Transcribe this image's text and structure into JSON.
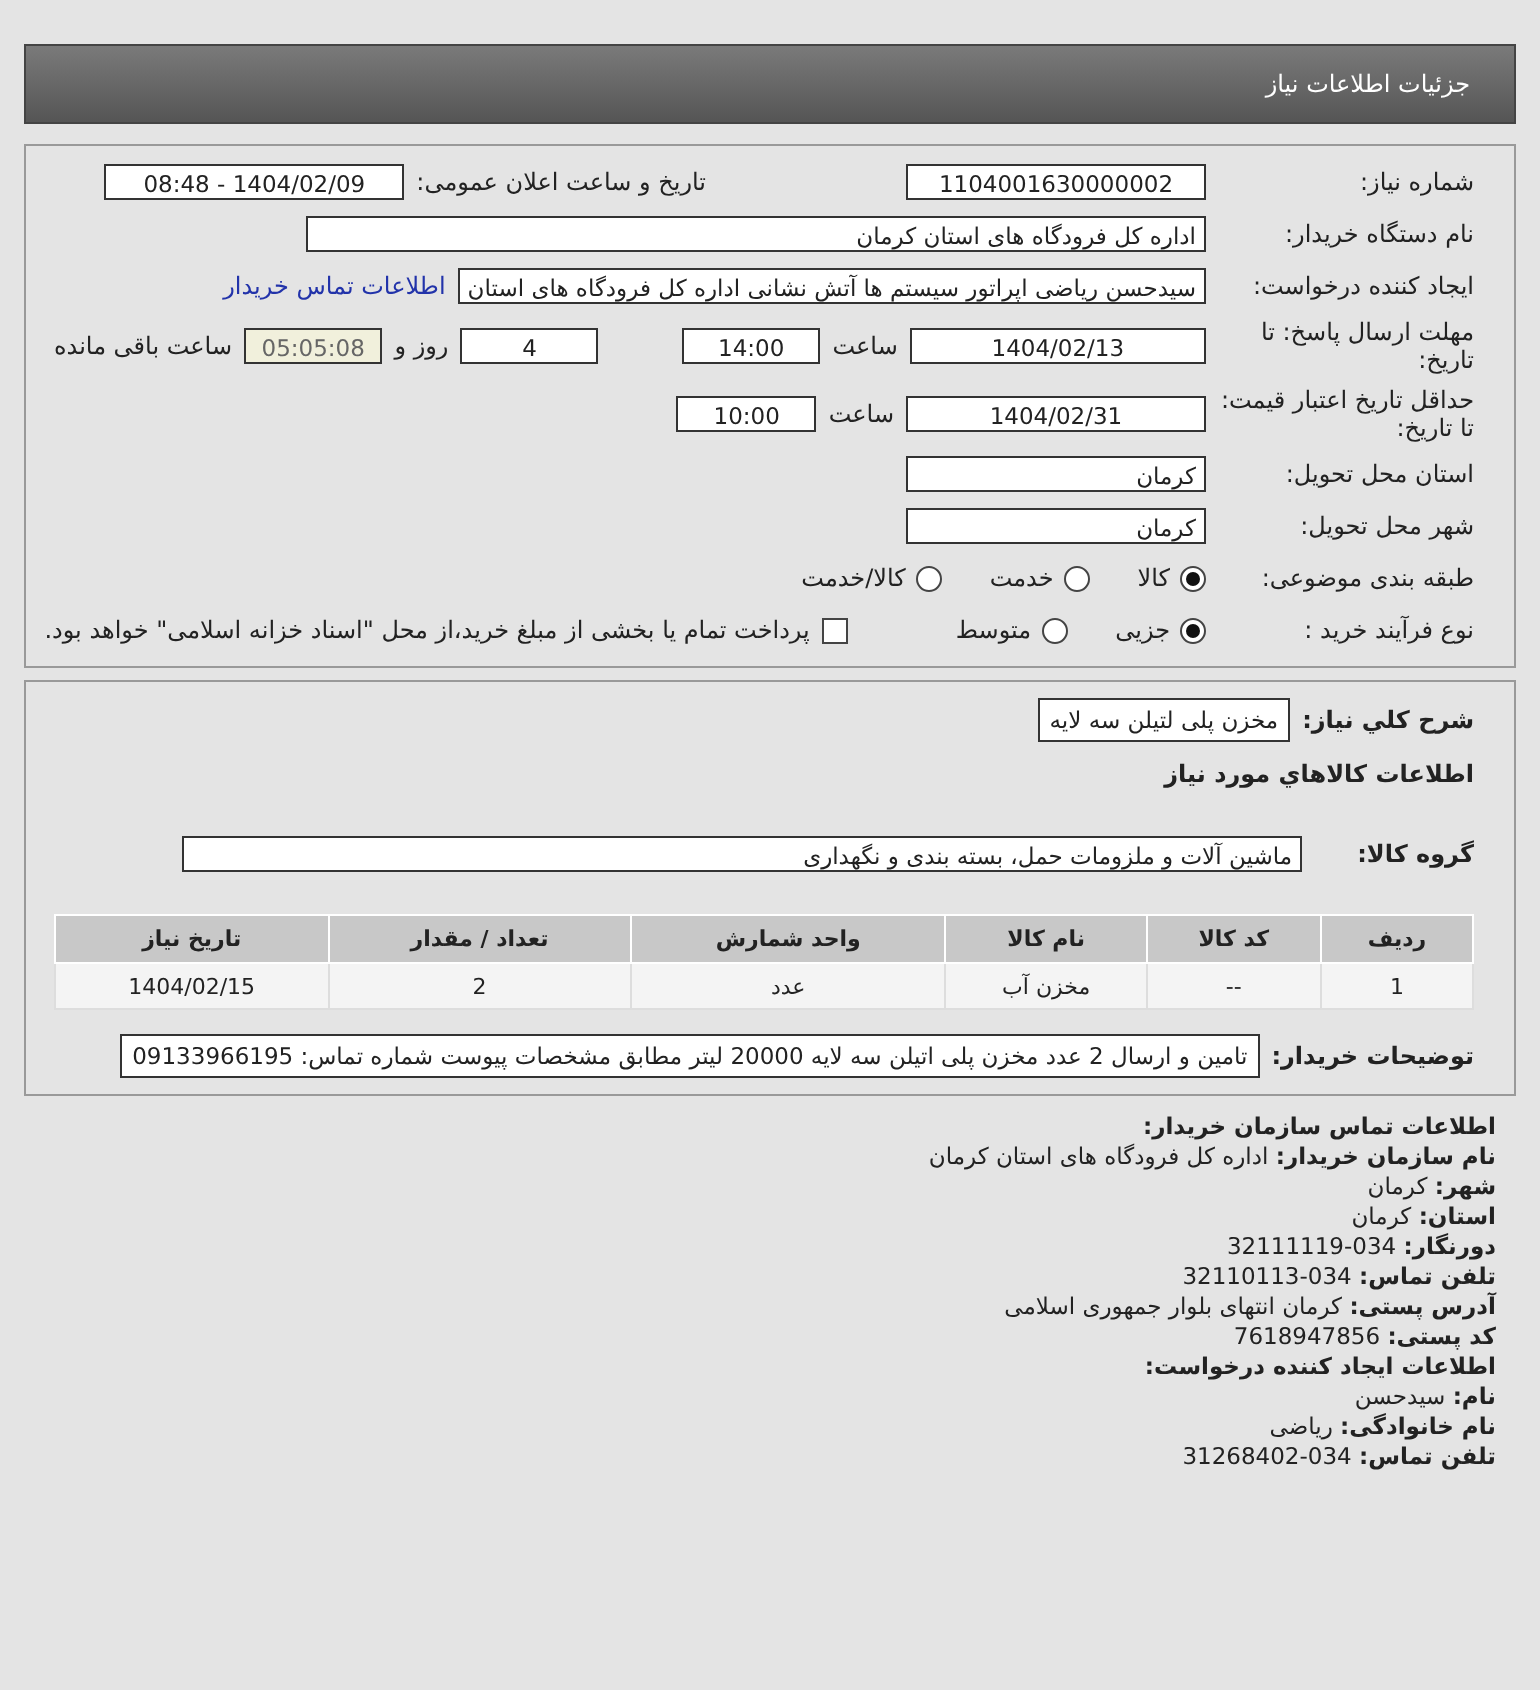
{
  "header": {
    "title": "جزئیات اطلاعات نیاز"
  },
  "details": {
    "need_number": {
      "label": "شماره نیاز:",
      "value": "1104001630000002"
    },
    "announce": {
      "label": "تاریخ و ساعت اعلان عمومی:",
      "value": "1404/02/09 - 08:48"
    },
    "buyer_org": {
      "label": "نام دستگاه خریدار:",
      "value": "اداره کل فرودگاه های استان کرمان"
    },
    "creator": {
      "label": "ایجاد کننده درخواست:",
      "value": "سیدحسن ریاضی اپراتور سیستم ها آتش نشانی اداره کل فرودگاه های استان",
      "link": "اطلاعات تماس خریدار"
    },
    "deadline": {
      "label": "مهلت ارسال پاسخ: تا تاریخ:",
      "date": "1404/02/13",
      "time_label": "ساعت",
      "time": "14:00",
      "days": "4",
      "days_label": "روز و",
      "remaining": "05:05:08",
      "remaining_label": "ساعت باقی مانده"
    },
    "validity": {
      "label": "حداقل تاریخ اعتبار قیمت: تا تاریخ:",
      "date": "1404/02/31",
      "time_label": "ساعت",
      "time": "10:00"
    },
    "province": {
      "label": "استان محل تحویل:",
      "value": "کرمان"
    },
    "city": {
      "label": "شهر محل تحویل:",
      "value": "کرمان"
    },
    "category": {
      "label": "طبقه بندی موضوعی:",
      "options": [
        {
          "label": "کالا",
          "selected": true
        },
        {
          "label": "خدمت",
          "selected": false
        },
        {
          "label": "کالا/خدمت",
          "selected": false
        }
      ]
    },
    "process": {
      "label": "نوع فرآیند خرید :",
      "options": [
        {
          "label": "جزیی",
          "selected": true
        },
        {
          "label": "متوسط",
          "selected": false
        }
      ],
      "payment": {
        "checked": false,
        "label": "پرداخت تمام یا بخشی از مبلغ خرید،از محل \"اسناد خزانه اسلامی\" خواهد بود."
      }
    }
  },
  "goods": {
    "summary": {
      "label": "شرح کلي نیاز:",
      "value": "مخزن پلی لتیلن سه لایه"
    },
    "heading": "اطلاعات کالاهاي مورد نیاز",
    "group": {
      "label": "گروه کالا:",
      "value": "ماشین آلات و ملزومات حمل، بسته بندی و نگهداری"
    },
    "table": {
      "columns": [
        "ردیف",
        "کد کالا",
        "نام کالا",
        "واحد شمارش",
        "تعداد / مقدار",
        "تاریخ نیاز"
      ],
      "rows": [
        [
          "1",
          "--",
          "مخزن آب",
          "عدد",
          "2",
          "1404/02/15"
        ]
      ]
    },
    "notes": {
      "label": "توضیحات خریدار:",
      "value": "تامین و ارسال 2 عدد مخزن پلی اتیلن سه لایه 20000 لیتر مطابق مشخصات پیوست شماره تماس: 09133966195"
    }
  },
  "contact": [
    {
      "kind": "heading",
      "label": "اطلاعات تماس سازمان خریدار:"
    },
    {
      "kind": "line",
      "label": "نام سازمان خریدار:",
      "value": "اداره کل فرودگاه های استان کرمان"
    },
    {
      "kind": "line",
      "label": "شهر:",
      "value": "کرمان"
    },
    {
      "kind": "line",
      "label": "استان:",
      "value": "کرمان"
    },
    {
      "kind": "line",
      "label": "دورنگار:",
      "value": "034-32111119"
    },
    {
      "kind": "line",
      "label": "تلفن تماس:",
      "value": "034-32110113"
    },
    {
      "kind": "line",
      "label": "آدرس پستی:",
      "value": "کرمان انتهای بلوار جمهوری اسلامی"
    },
    {
      "kind": "line",
      "label": "کد پستی:",
      "value": "7618947856"
    },
    {
      "kind": "heading",
      "label": "اطلاعات ایجاد کننده درخواست:"
    },
    {
      "kind": "line",
      "label": "نام:",
      "value": "سیدحسن"
    },
    {
      "kind": "line",
      "label": "نام خانوادگی:",
      "value": "ریاضی"
    },
    {
      "kind": "line",
      "label": "تلفن تماس:",
      "value": "034-31268402"
    }
  ]
}
